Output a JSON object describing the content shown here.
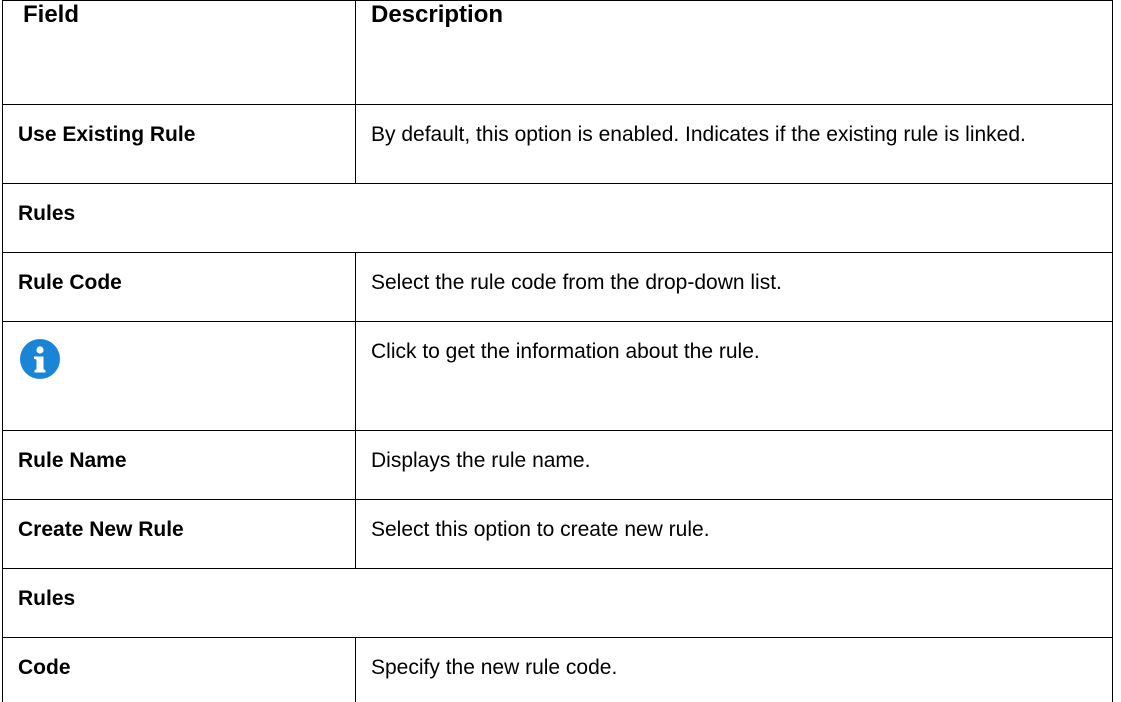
{
  "table": {
    "headers": {
      "field": "Field",
      "description": "Description"
    },
    "rows": [
      {
        "type": "row",
        "field": "Use Existing Rule",
        "description": "By default, this option is enabled. Indicates if the existing rule is linked."
      },
      {
        "type": "section",
        "label": "Rules"
      },
      {
        "type": "row",
        "field": "Rule Code",
        "description": "Select the rule code from the drop-down list."
      },
      {
        "type": "icon-row",
        "icon": "info-icon",
        "icon_color": "#1a85d6",
        "description": "Click to get the information about the rule."
      },
      {
        "type": "row",
        "field": "Rule Name",
        "description": "Displays the rule name."
      },
      {
        "type": "row",
        "field": "Create New Rule",
        "description": "Select this option to create new rule."
      },
      {
        "type": "section",
        "label": "Rules"
      },
      {
        "type": "row",
        "field": "Code",
        "description": "Specify the new rule code."
      }
    ]
  }
}
